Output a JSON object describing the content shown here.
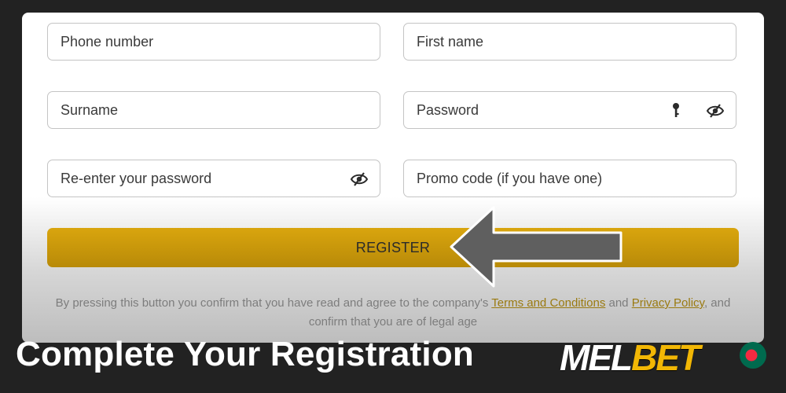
{
  "form": {
    "fields": {
      "phone": {
        "placeholder": "Phone number"
      },
      "first_name": {
        "placeholder": "First name"
      },
      "surname": {
        "placeholder": "Surname"
      },
      "password": {
        "placeholder": "Password"
      },
      "reenter_password": {
        "placeholder": "Re-enter your password"
      },
      "promo": {
        "placeholder": "Promo code (if you have one)"
      }
    },
    "register_label": "REGISTER",
    "legal": {
      "prefix": "By pressing this button you confirm that you have read and agree to the company's",
      "terms_link": "Terms and Conditions",
      "and": "and",
      "privacy_link": "Privacy Policy",
      "suffix": ", and confirm that you are of legal age"
    }
  },
  "banner": {
    "title": "Complete Your Registration",
    "logo_part1": "MEL",
    "logo_part2": "BET"
  },
  "icons": {
    "password_key": "key-icon",
    "password_visibility": "eye-hidden-icon",
    "reenter_visibility": "eye-hidden-icon",
    "pointer": "arrow-left-icon",
    "flag": "bangladesh-flag-icon"
  },
  "colors": {
    "accent": "#d9a50e",
    "background": "#222222",
    "logo_accent": "#f2b705",
    "flag_green": "#006a4e",
    "flag_red": "#f42a41"
  }
}
